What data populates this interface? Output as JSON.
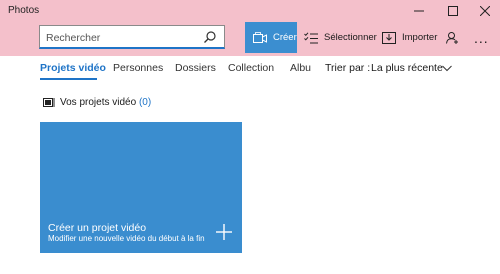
{
  "window": {
    "title": "Photos"
  },
  "search": {
    "placeholder": "Rechercher"
  },
  "commands": {
    "create": "Créer",
    "select": "Sélectionner",
    "import": "Importer",
    "more": "..."
  },
  "tabs": [
    {
      "label": "Projets vidéo",
      "active": true
    },
    {
      "label": "Personnes"
    },
    {
      "label": "Dossiers"
    },
    {
      "label": "Collection"
    },
    {
      "label": "Albu"
    }
  ],
  "sort": {
    "label": "Trier par :",
    "value": "La plus récente"
  },
  "section": {
    "title": "Vos projets vidéo",
    "count": "(0)"
  },
  "tile": {
    "title": "Créer un projet vidéo",
    "subtitle": "Modifier une nouvelle vidéo du début à la fin"
  },
  "colors": {
    "title_bar": "#f4c0cb",
    "accent": "#1f74c7",
    "tile": "#3a8dcf"
  },
  "icons": [
    "minimize-icon",
    "maximize-icon",
    "close-icon",
    "search-icon",
    "video-edit-icon",
    "select-list-icon",
    "import-icon",
    "person-icon",
    "more-icon",
    "chevron-down-icon",
    "projects-icon",
    "plus-icon"
  ]
}
